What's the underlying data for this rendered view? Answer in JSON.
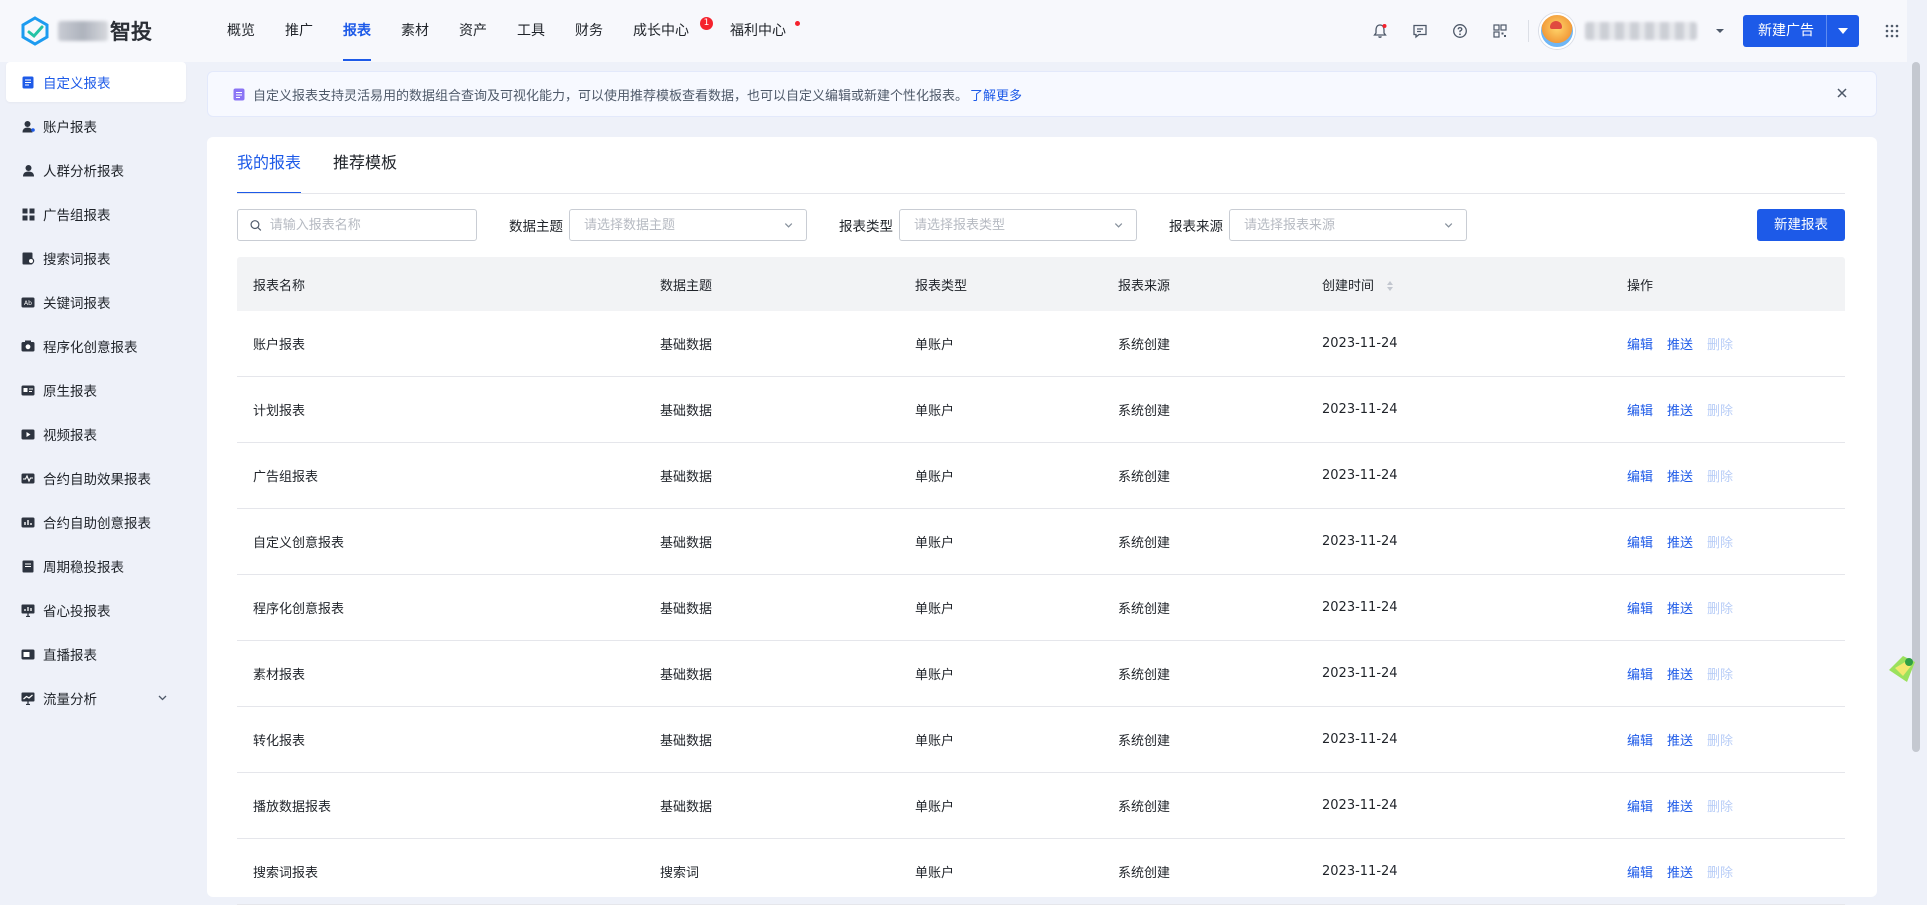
{
  "app": {
    "brand_text": "智投"
  },
  "nav": [
    {
      "label": "概览"
    },
    {
      "label": "推广"
    },
    {
      "label": "报表",
      "active": true
    },
    {
      "label": "素材"
    },
    {
      "label": "资产"
    },
    {
      "label": "工具"
    },
    {
      "label": "财务"
    },
    {
      "label": "成长中心",
      "badge": "1"
    },
    {
      "label": "福利中心",
      "dot": true
    }
  ],
  "header": {
    "new_ad_label": "新建广告"
  },
  "sidebar": {
    "items": [
      {
        "label": "自定义报表",
        "active": true
      },
      {
        "label": "账户报表"
      },
      {
        "label": "人群分析报表"
      },
      {
        "label": "广告组报表"
      },
      {
        "label": "搜索词报表"
      },
      {
        "label": "关键词报表"
      },
      {
        "label": "程序化创意报表"
      },
      {
        "label": "原生报表"
      },
      {
        "label": "视频报表"
      },
      {
        "label": "合约自助效果报表"
      },
      {
        "label": "合约自助创意报表"
      },
      {
        "label": "周期稳投报表"
      },
      {
        "label": "省心投报表"
      },
      {
        "label": "直播报表"
      },
      {
        "label": "流量分析"
      }
    ]
  },
  "banner": {
    "text": "自定义报表支持灵活易用的数据组合查询及可视化能力，可以使用推荐模板查看数据，也可以自定义编辑或新建个性化报表。",
    "link": "了解更多"
  },
  "tabs": [
    {
      "label": "我的报表",
      "active": true
    },
    {
      "label": "推荐模板"
    }
  ],
  "filters": {
    "search_placeholder": "请输入报表名称",
    "theme_label": "数据主题",
    "theme_placeholder": "请选择数据主题",
    "type_label": "报表类型",
    "type_placeholder": "请选择报表类型",
    "source_label": "报表来源",
    "source_placeholder": "请选择报表来源",
    "new_report_label": "新建报表"
  },
  "table": {
    "headers": [
      "报表名称",
      "数据主题",
      "报表类型",
      "报表来源",
      "创建时间",
      "操作"
    ],
    "actions": {
      "edit": "编辑",
      "push": "推送",
      "delete": "删除"
    },
    "rows": [
      {
        "name": "账户报表",
        "theme": "基础数据",
        "type": "单账户",
        "source": "系统创建",
        "created": "2023-11-24"
      },
      {
        "name": "计划报表",
        "theme": "基础数据",
        "type": "单账户",
        "source": "系统创建",
        "created": "2023-11-24"
      },
      {
        "name": "广告组报表",
        "theme": "基础数据",
        "type": "单账户",
        "source": "系统创建",
        "created": "2023-11-24"
      },
      {
        "name": "自定义创意报表",
        "theme": "基础数据",
        "type": "单账户",
        "source": "系统创建",
        "created": "2023-11-24"
      },
      {
        "name": "程序化创意报表",
        "theme": "基础数据",
        "type": "单账户",
        "source": "系统创建",
        "created": "2023-11-24"
      },
      {
        "name": "素材报表",
        "theme": "基础数据",
        "type": "单账户",
        "source": "系统创建",
        "created": "2023-11-24"
      },
      {
        "name": "转化报表",
        "theme": "基础数据",
        "type": "单账户",
        "source": "系统创建",
        "created": "2023-11-24"
      },
      {
        "name": "播放数据报表",
        "theme": "基础数据",
        "type": "单账户",
        "source": "系统创建",
        "created": "2023-11-24"
      },
      {
        "name": "搜索词报表",
        "theme": "搜索词",
        "type": "单账户",
        "source": "系统创建",
        "created": "2023-11-24"
      }
    ]
  },
  "colors": {
    "primary": "#1d5ae8",
    "disabled_link": "#b8cdf7",
    "badge": "#f5222d"
  }
}
